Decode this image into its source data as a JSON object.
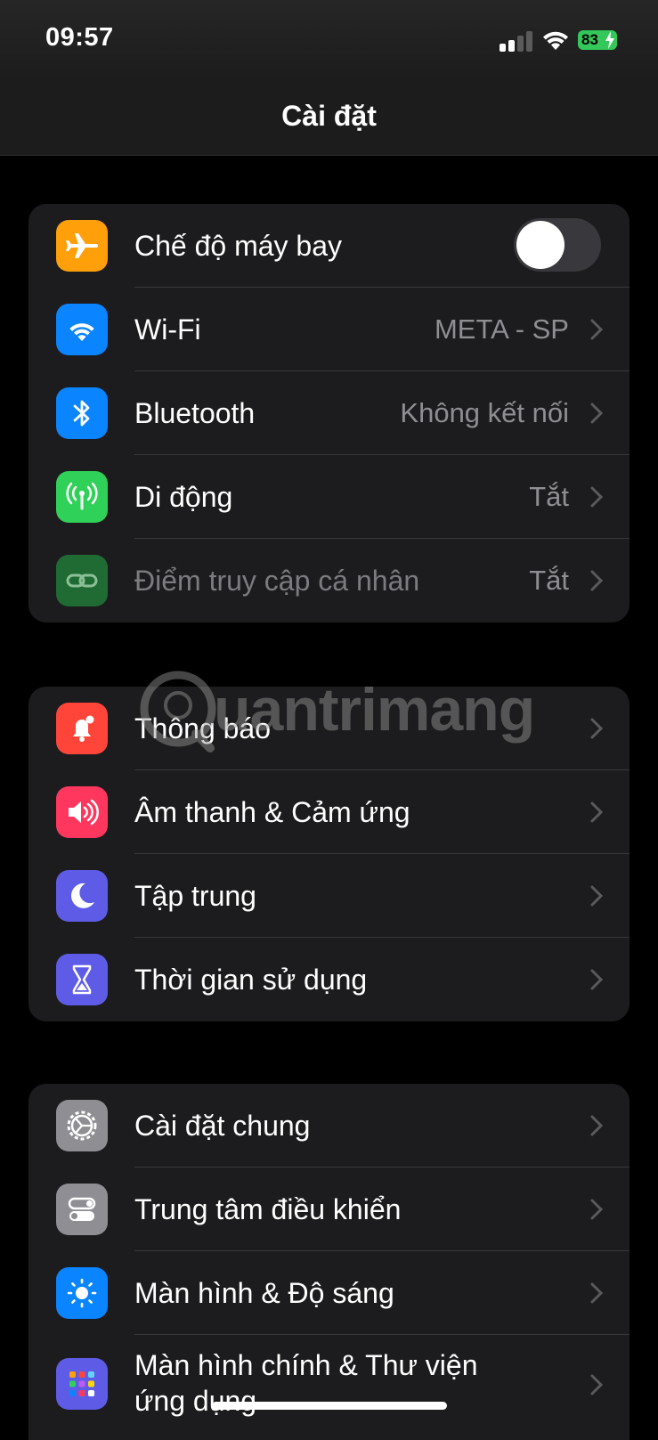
{
  "status_bar": {
    "time": "09:57",
    "battery": "83"
  },
  "header": {
    "title": "Cài đặt"
  },
  "groups": [
    {
      "rows": [
        {
          "label": "Chế độ máy bay",
          "toggle_on": false,
          "icon": "airplane-icon",
          "color": "#ff9f0a"
        },
        {
          "label": "Wi-Fi",
          "value": "META - SP",
          "icon": "wifi-icon",
          "color": "#0a84ff"
        },
        {
          "label": "Bluetooth",
          "value": "Không kết nối",
          "icon": "bluetooth-icon",
          "color": "#0a84ff"
        },
        {
          "label": "Di động",
          "value": "Tắt",
          "icon": "cellular-icon",
          "color": "#30d158"
        },
        {
          "label": "Điểm truy cập cá nhân",
          "value": "Tắt",
          "icon": "hotspot-icon",
          "color": "#1f6b33",
          "disabled": true
        }
      ]
    },
    {
      "rows": [
        {
          "label": "Thông báo",
          "icon": "bell-icon",
          "color": "#ff453a"
        },
        {
          "label": "Âm thanh & Cảm ứng",
          "icon": "speaker-icon",
          "color": "#ff375f"
        },
        {
          "label": "Tập trung",
          "icon": "moon-icon",
          "color": "#5e5ce6"
        },
        {
          "label": "Thời gian sử dụng",
          "icon": "hourglass-icon",
          "color": "#5e5ce6"
        }
      ]
    },
    {
      "rows": [
        {
          "label": "Cài đặt chung",
          "icon": "gear-icon",
          "color": "#8e8e93"
        },
        {
          "label": "Trung tâm điều khiển",
          "icon": "switches-icon",
          "color": "#8e8e93"
        },
        {
          "label": "Màn hình & Độ sáng",
          "icon": "sun-icon",
          "color": "#0a84ff"
        },
        {
          "label": "Màn hình chính & Thư viện ứng dụng",
          "icon": "home-grid-icon",
          "color": "#5e5ce6"
        }
      ]
    }
  ],
  "watermark": {
    "text": "uantrimang"
  }
}
